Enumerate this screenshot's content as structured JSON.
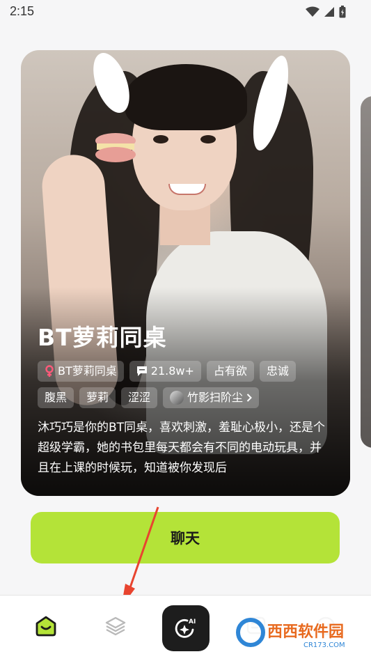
{
  "status_bar": {
    "time": "2:15"
  },
  "card": {
    "title": "BT萝莉同桌",
    "tags_row1": [
      {
        "label": "BT萝莉同桌",
        "icon": "female-icon"
      },
      {
        "label": "21.8w+",
        "icon": "chat-count-icon"
      },
      {
        "label": "占有欲"
      },
      {
        "label": "忠诚"
      }
    ],
    "tags_row2": [
      {
        "label": "腹黑"
      },
      {
        "label": "萝莉"
      },
      {
        "label": "涩涩"
      },
      {
        "label": "竹影扫阶尘",
        "icon": "creator-avatar"
      }
    ],
    "description": "沐巧巧是你的BT同桌，喜欢刺激，羞耻心极小，还是个超级学霸，她的书包里每天都会有不同的电动玩具，并且在上课的时候玩，知道被你发现后"
  },
  "chat_button": {
    "label": "聊天"
  },
  "bottom_nav": {
    "items": [
      "home-icon",
      "layers-icon",
      "ai-create-icon",
      "message-icon",
      "profile-icon"
    ],
    "ai_label": "AI"
  },
  "watermark": {
    "text": "西西软件园",
    "sub": "CR173.COM"
  },
  "colors": {
    "accent": "#b4e338",
    "nav_active": "#b4e338",
    "dark": "#1d1d1d"
  }
}
